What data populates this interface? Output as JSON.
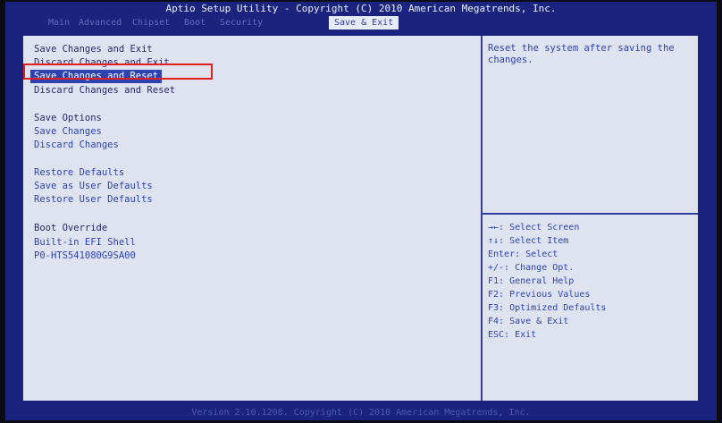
{
  "header": {
    "title": "Aptio Setup Utility - Copyright (C) 2010 American Megatrends, Inc.",
    "tabs": [
      {
        "label": "Main"
      },
      {
        "label": "Advanced"
      },
      {
        "label": "Chipset"
      },
      {
        "label": "Boot"
      },
      {
        "label": "Security"
      },
      {
        "label": "Save & Exit"
      }
    ]
  },
  "menu": {
    "items": [
      {
        "label": "Save Changes and Exit"
      },
      {
        "label": "Discard Changes and Exit"
      },
      {
        "label": "Save Changes and Reset"
      },
      {
        "label": "Discard Changes and Reset"
      },
      {
        "label": "Save Options"
      },
      {
        "label": "Save Changes"
      },
      {
        "label": "Discard Changes"
      },
      {
        "label": "Restore Defaults"
      },
      {
        "label": "Save as User Defaults"
      },
      {
        "label": "Restore User Defaults"
      },
      {
        "label": "Boot Override"
      },
      {
        "label": "Built-in EFI Shell"
      },
      {
        "label": "P0-HTS541080G9SA00"
      }
    ]
  },
  "help": {
    "text": "Reset the system after saving the changes."
  },
  "keys": [
    {
      "label": "→←: Select Screen"
    },
    {
      "label": "↑↓: Select Item"
    },
    {
      "label": "Enter: Select"
    },
    {
      "label": "+/-: Change Opt."
    },
    {
      "label": "F1: General Help"
    },
    {
      "label": "F2: Previous Values"
    },
    {
      "label": "F3: Optimized Defaults"
    },
    {
      "label": "F4: Save & Exit"
    },
    {
      "label": "ESC: Exit"
    }
  ],
  "footer": {
    "text": "Version 2.10.1208. Copyright (C) 2010 American Megatrends, Inc."
  },
  "colors": {
    "background": "#1a237e",
    "panel": "#dfe3ef",
    "selected": "#2c42b0",
    "highlight_border": "#e02020"
  }
}
